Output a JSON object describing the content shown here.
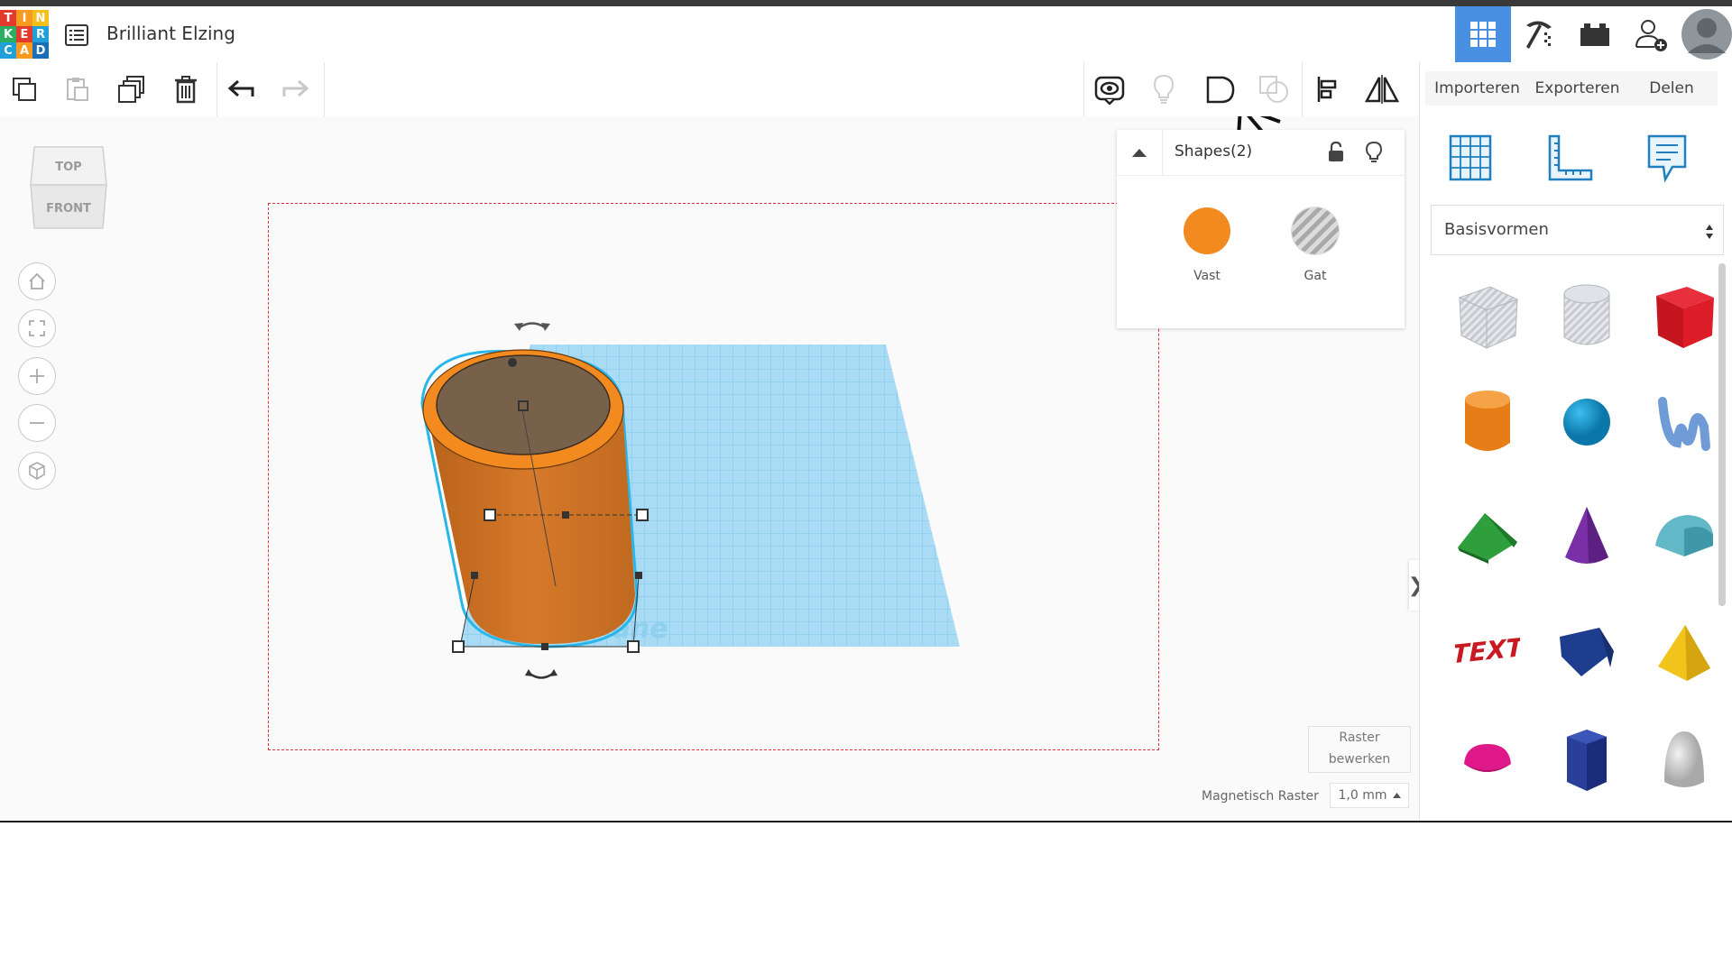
{
  "app": {
    "logo_letters": [
      "T",
      "I",
      "N",
      "K",
      "E",
      "R",
      "C",
      "A",
      "D"
    ],
    "logo_colors": [
      "#e23b2e",
      "#f79a1f",
      "#f5c01c",
      "#2cae61",
      "#e23b2e",
      "#1fa0d8",
      "#1fa0d8",
      "#f79a1f",
      "#1a6eb7"
    ],
    "design_title": "Brilliant Elzing"
  },
  "header": {
    "buttons": [
      "3d-design-view",
      "codeblocks",
      "bricks",
      "invite-users",
      "profile"
    ]
  },
  "toolbar": {
    "import_label": "Importeren",
    "export_label": "Exporteren",
    "share_label": "Delen"
  },
  "viewcube": {
    "top_label": "TOP",
    "front_label": "FRONT"
  },
  "inspector": {
    "title": "Shapes(2)",
    "solid_label": "Vast",
    "hole_label": "Gat",
    "solid_color": "#f28a20"
  },
  "grid_controls": {
    "edit_grid_line1": "Raster",
    "edit_grid_line2": "bewerken",
    "snap_label": "Magnetisch Raster",
    "snap_value": "1,0 mm"
  },
  "library": {
    "category": "Basisvormen",
    "shapes": [
      "box-hole",
      "cylinder-hole",
      "box",
      "cylinder",
      "sphere",
      "scribble",
      "roof",
      "cone",
      "round-roof",
      "text",
      "wedge",
      "pyramid",
      "half-sphere",
      "polygon",
      "paraboloid"
    ]
  },
  "workplane": {
    "watermark": "Workplane"
  }
}
